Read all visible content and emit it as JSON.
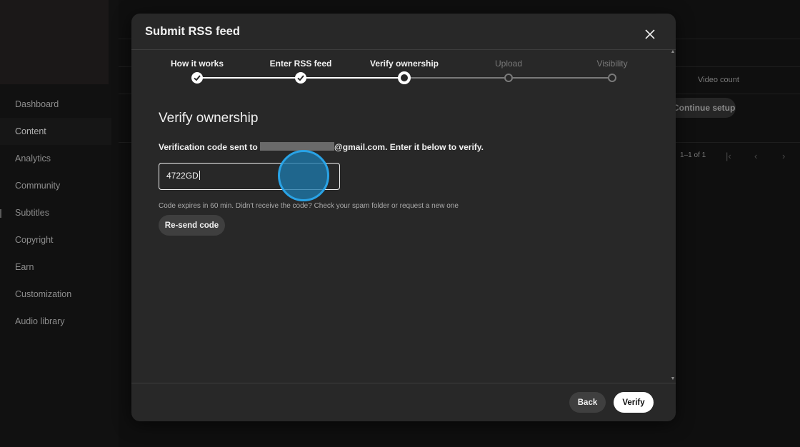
{
  "sidebar": {
    "items": [
      {
        "label": "Dashboard"
      },
      {
        "label": "Content"
      },
      {
        "label": "Analytics"
      },
      {
        "label": "Community"
      },
      {
        "label": "Subtitles"
      },
      {
        "label": "Copyright"
      },
      {
        "label": "Earn"
      },
      {
        "label": "Customization"
      },
      {
        "label": "Audio library"
      }
    ]
  },
  "background": {
    "video_count_header": "Video count",
    "continue_setup": "Continue setup",
    "pagination": "1–1 of 1"
  },
  "modal": {
    "title": "Submit RSS feed",
    "close_icon": "close-icon",
    "steps": [
      {
        "label": "How it works",
        "state": "done"
      },
      {
        "label": "Enter RSS feed",
        "state": "done"
      },
      {
        "label": "Verify ownership",
        "state": "current"
      },
      {
        "label": "Upload",
        "state": "pending"
      },
      {
        "label": "Visibility",
        "state": "pending"
      }
    ],
    "heading": "Verify ownership",
    "message_prefix": "Verification code sent to",
    "message_email_suffix": "@gmail.com",
    "message_suffix": ". Enter it below to verify.",
    "code_input_value": "4722GD",
    "helper_text": "Code expires in 60 min. Didn't receive the code? Check your spam folder or request a new one",
    "resend_label": "Re-send code",
    "back_label": "Back",
    "verify_label": "Verify"
  },
  "colors": {
    "modal_bg": "#282828",
    "page_bg": "#0f0f0f",
    "step_done": "#ffffff",
    "step_pending": "#7a7a7a",
    "click_indicator": "#29a3e6"
  }
}
